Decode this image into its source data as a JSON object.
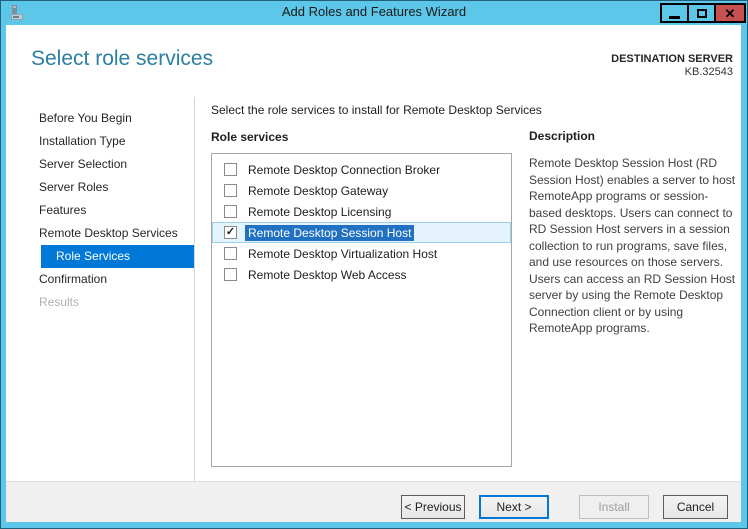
{
  "window": {
    "title": "Add Roles and Features Wizard"
  },
  "icons": {
    "app": "server-icon",
    "minimize": "minimize-icon",
    "maximize": "maximize-icon",
    "close_glyph": "✕",
    "checkmark_glyph": "✓"
  },
  "colors": {
    "titlebar_blue": "#5CC7E8",
    "close_button_red": "#C75050",
    "heading_blue": "#2B7FA3",
    "sidebar_selection": "#0078D7",
    "list_label_selection": "#2071C2",
    "selected_row_bg": "#E5F3FC"
  },
  "header": {
    "title": "Select role services",
    "destination_label": "DESTINATION SERVER",
    "destination_value": "KB.32543"
  },
  "sidebar": {
    "items": [
      {
        "label": "Before You Begin",
        "state": "normal"
      },
      {
        "label": "Installation Type",
        "state": "normal"
      },
      {
        "label": "Server Selection",
        "state": "normal"
      },
      {
        "label": "Server Roles",
        "state": "normal"
      },
      {
        "label": "Features",
        "state": "normal"
      },
      {
        "label": "Remote Desktop Services",
        "state": "normal"
      },
      {
        "label": "Role Services",
        "state": "selected"
      },
      {
        "label": "Confirmation",
        "state": "normal"
      },
      {
        "label": "Results",
        "state": "disabled"
      }
    ]
  },
  "main": {
    "instruction": "Select the role services to install for Remote Desktop Services",
    "list_label": "Role services",
    "role_services": [
      {
        "label": "Remote Desktop Connection Broker",
        "checked": false,
        "selected": false
      },
      {
        "label": "Remote Desktop Gateway",
        "checked": false,
        "selected": false
      },
      {
        "label": "Remote Desktop Licensing",
        "checked": false,
        "selected": false
      },
      {
        "label": "Remote Desktop Session Host",
        "checked": true,
        "selected": true
      },
      {
        "label": "Remote Desktop Virtualization Host",
        "checked": false,
        "selected": false
      },
      {
        "label": "Remote Desktop Web Access",
        "checked": false,
        "selected": false
      }
    ]
  },
  "description": {
    "title": "Description",
    "body": "Remote Desktop Session Host (RD Session Host) enables a server to host RemoteApp programs or session-based desktops. Users can connect to RD Session Host servers in a session collection to run programs, save files, and use resources on those servers. Users can access an RD Session Host server by using the Remote Desktop Connection client or by using RemoteApp programs."
  },
  "footer": {
    "buttons": [
      {
        "label": "< Previous",
        "state": "normal"
      },
      {
        "label": "Next >",
        "state": "default"
      },
      {
        "label": "Install",
        "state": "disabled"
      },
      {
        "label": "Cancel",
        "state": "normal"
      }
    ]
  }
}
